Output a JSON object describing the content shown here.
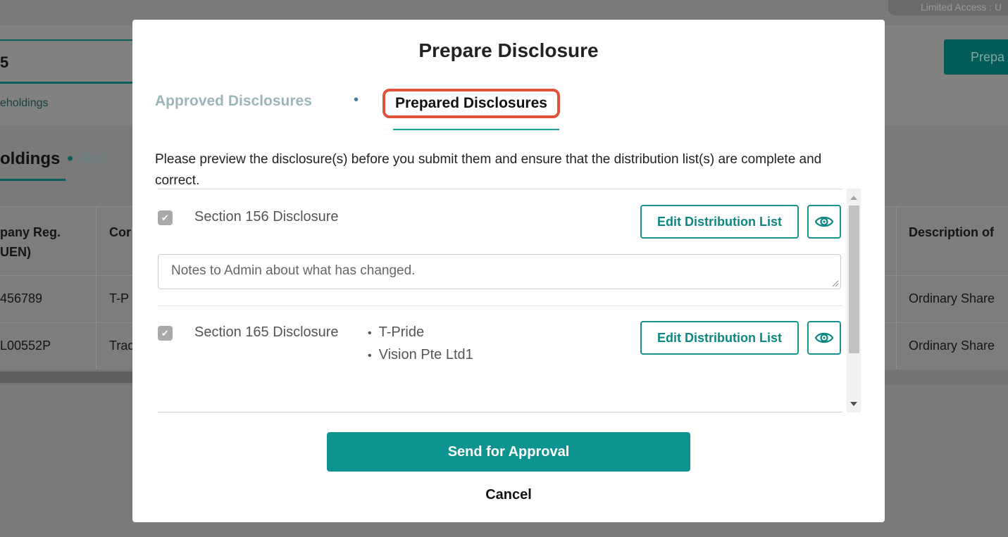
{
  "background": {
    "access_label": "Limited Access : U",
    "count": "5",
    "subtitle": "eholdings",
    "prepare_button": "Prepa",
    "tabs": {
      "active": "oldings",
      "separator": "•",
      "inactive": "Rel"
    },
    "table": {
      "headers": [
        "pany Reg.",
        "UEN)",
        "Cor",
        "Description of"
      ],
      "rows": [
        {
          "reg": "456789",
          "company": "T-P",
          "description": "Ordinary Share"
        },
        {
          "reg": "L00552P",
          "company": "Trad",
          "description": "Ordinary Share"
        }
      ]
    }
  },
  "modal": {
    "title": "Prepare Disclosure",
    "tabs": {
      "approved": "Approved Disclosures",
      "separator": "•",
      "prepared": "Prepared Disclosures"
    },
    "intro": "Please preview the disclosure(s) before you submit them and ensure that the distribution list(s) are complete and correct.",
    "disclosures": [
      {
        "label": "Section 156 Disclosure",
        "edit_label": "Edit Distribution List",
        "notes_placeholder": "Notes to Admin about what has changed."
      },
      {
        "label": "Section 165 Disclosure",
        "entities": [
          "T-Pride",
          "Vision Pte Ltd1"
        ],
        "edit_label": "Edit Distribution List"
      }
    ],
    "send_button": "Send for Approval",
    "cancel_button": "Cancel"
  },
  "colors": {
    "accent": "#0d9490",
    "highlight_border": "#e0523d",
    "overlay": "#7a7a7a"
  },
  "icons": [
    "eye-icon",
    "check-icon",
    "logout-icon"
  ]
}
